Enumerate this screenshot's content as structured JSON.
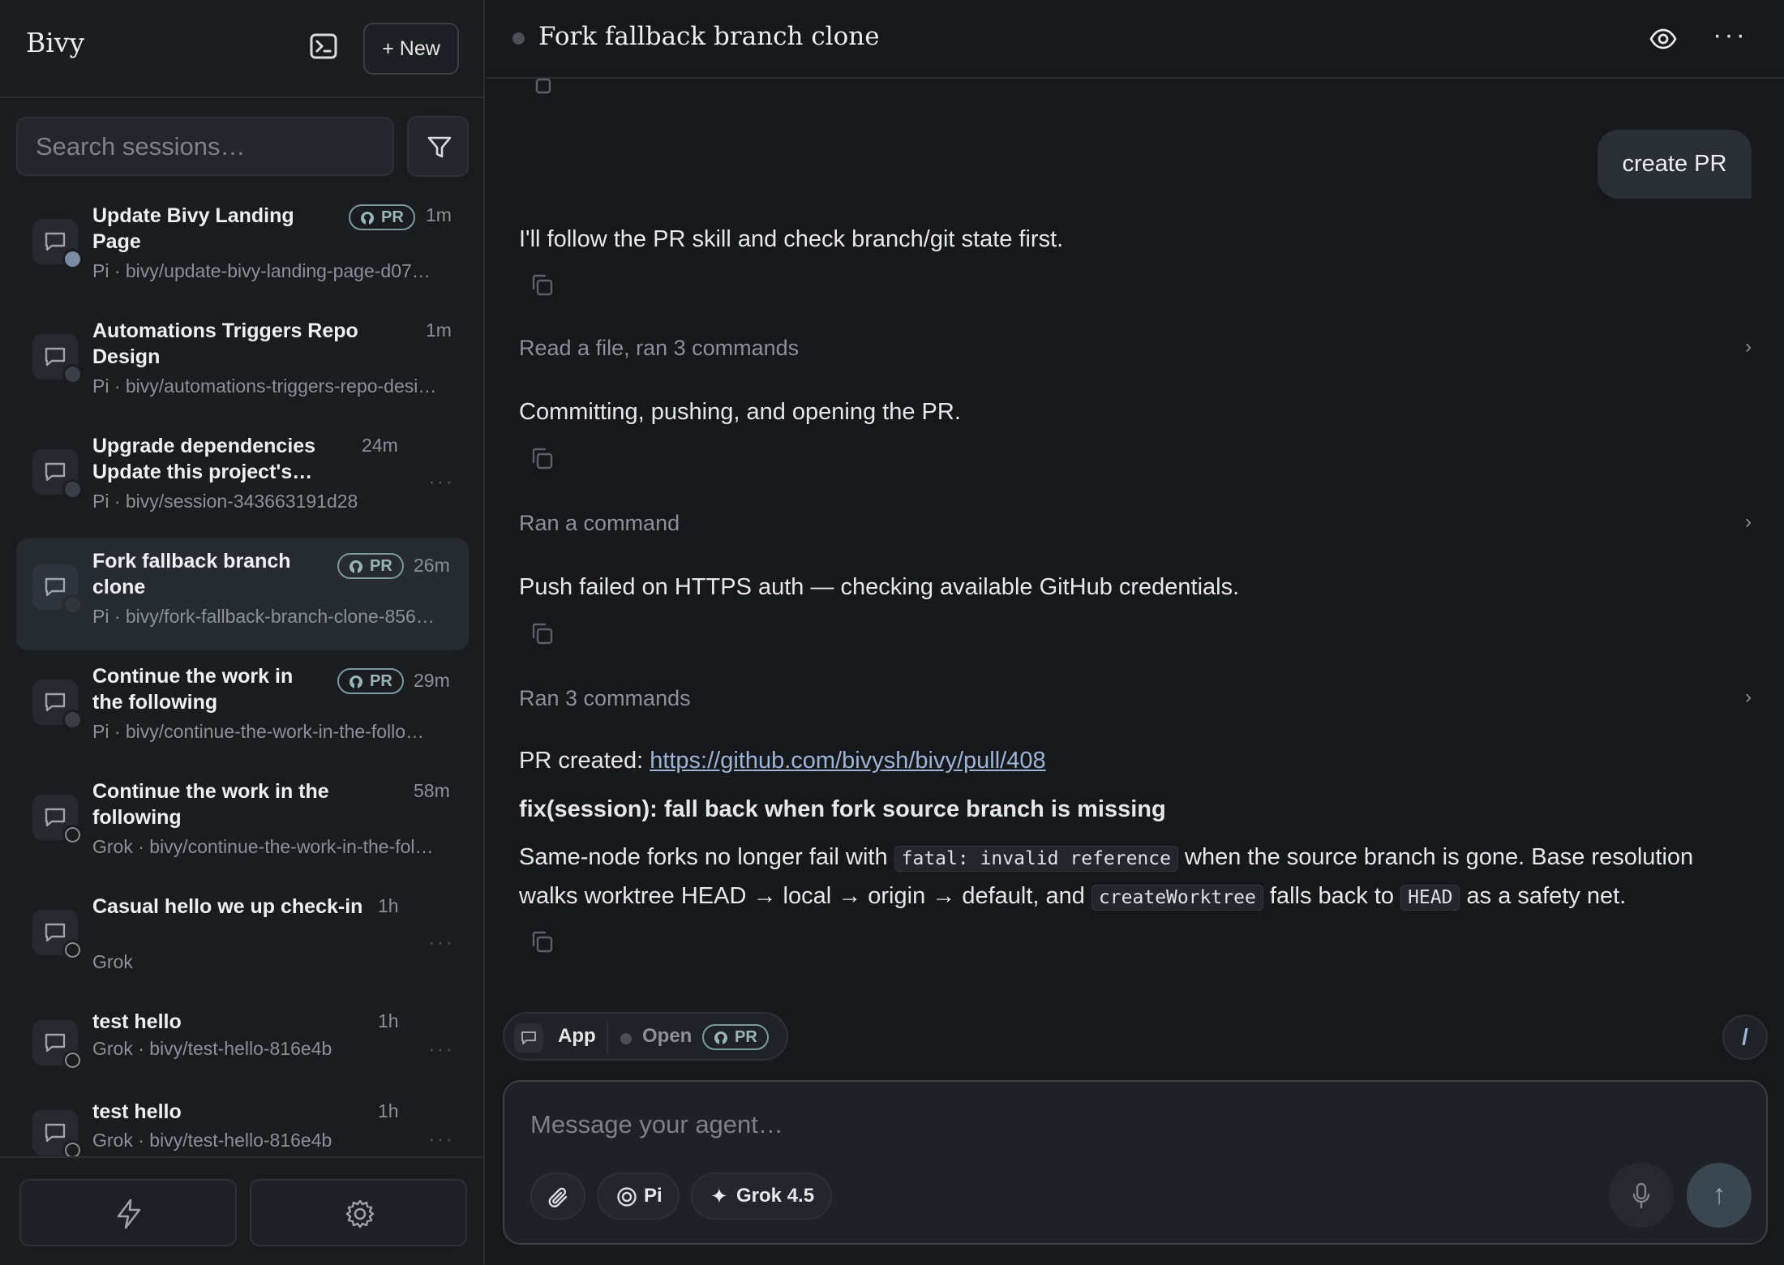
{
  "sidebar": {
    "brand": "Bivy",
    "new_label": "+ New",
    "search_placeholder": "Search sessions…",
    "sessions": [
      {
        "title": "Update Bivy Landing Page",
        "subtitle": "Pi · bivy/update-bivy-landing-page-d07…",
        "time": "1m",
        "badge": "PR"
      },
      {
        "title": "Automations Triggers Repo Design",
        "subtitle": "Pi · bivy/automations-triggers-repo-desi…",
        "time": "1m"
      },
      {
        "title": "Upgrade dependencies Update this project's…",
        "subtitle": "Pi · bivy/session-343663191d28",
        "time": "24m"
      },
      {
        "title": "Fork fallback branch clone",
        "subtitle": "Pi · bivy/fork-fallback-branch-clone-856…",
        "time": "26m",
        "badge": "PR"
      },
      {
        "title": "Continue the work in the following",
        "subtitle": "Pi · bivy/continue-the-work-in-the-follo…",
        "time": "29m",
        "badge": "PR"
      },
      {
        "title": "Continue the work in the following",
        "subtitle": "Grok · bivy/continue-the-work-in-the-fol…",
        "time": "58m"
      },
      {
        "title": "Casual hello we up check-in",
        "subtitle": "Grok",
        "time": "1h"
      },
      {
        "title": "test hello",
        "subtitle": "Grok · bivy/test-hello-816e4b",
        "time": "1h"
      },
      {
        "title": "test hello",
        "subtitle": "Grok · bivy/test-hello-816e4b",
        "time": "1h"
      }
    ]
  },
  "header": {
    "title": "Fork fallback branch clone"
  },
  "conversation": {
    "user_message": "create PR",
    "msg1": "I'll follow the PR skill and check branch/git state first.",
    "tool1": "Read a file, ran 3 commands",
    "msg2": "Committing, pushing, and opening the PR.",
    "tool2": "Ran a command",
    "msg3": "Push failed on HTTPS auth — checking available GitHub credentials.",
    "tool3": "Ran 3 commands",
    "pr_prefix": "PR created: ",
    "pr_url": "https://github.com/bivysh/bivy/pull/408",
    "pr_title": "fix(session): fall back when fork source branch is missing",
    "para": {
      "t1": "Same-node forks no longer fail with ",
      "c1": "fatal: invalid reference",
      "t2": " when the source branch is gone. Base resolution walks worktree HEAD → local → origin → default, and ",
      "c2": "createWorktree",
      "t3": " falls back to ",
      "c3": "HEAD",
      "t4": " as a safety net."
    }
  },
  "context_bar": {
    "app_label": "App",
    "status_label": "Open",
    "badge": "PR"
  },
  "composer": {
    "placeholder": "Message your agent…",
    "agent": "Pi",
    "model": "Grok 4.5",
    "slash": "/",
    "send": "↑"
  },
  "colors": {
    "background": "#16181c",
    "sidebar": "#1a1c20",
    "link": "#9db4d6",
    "pr_badge": "#7a9a9e"
  }
}
